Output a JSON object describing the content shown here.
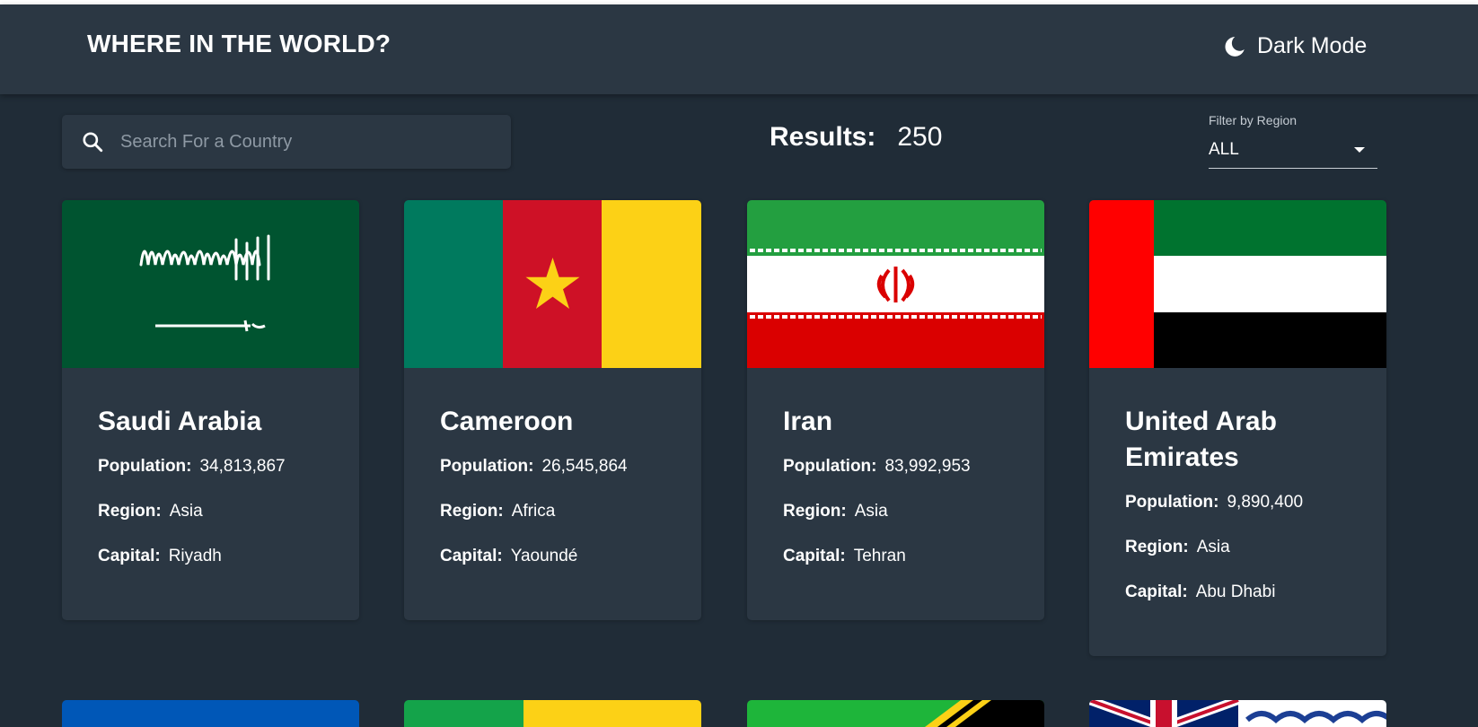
{
  "header": {
    "title": "WHERE IN THE WORLD?",
    "theme_toggle_label": "Dark Mode",
    "theme_toggle_icon": "moon-icon"
  },
  "search": {
    "placeholder": "Search For a Country",
    "value": "",
    "icon": "search-icon"
  },
  "results": {
    "label": "Results:",
    "count": "250"
  },
  "filter": {
    "label": "Filter by Region",
    "selected": "ALL"
  },
  "labels": {
    "population": "Population:",
    "region": "Region:",
    "capital": "Capital:"
  },
  "countries": [
    {
      "name": "Saudi Arabia",
      "population": "34,813,867",
      "region": "Asia",
      "capital": "Riyadh",
      "flag": "saudi-arabia-flag"
    },
    {
      "name": "Cameroon",
      "population": "26,545,864",
      "region": "Africa",
      "capital": "Yaoundé",
      "flag": "cameroon-flag"
    },
    {
      "name": "Iran",
      "population": "83,992,953",
      "region": "Asia",
      "capital": "Tehran",
      "flag": "iran-flag"
    },
    {
      "name": "United Arab Emirates",
      "population": "9,890,400",
      "region": "Asia",
      "capital": "Abu Dhabi",
      "flag": "uae-flag"
    }
  ],
  "colors": {
    "background": "#202c37",
    "surface": "#2b3743",
    "text": "#ffffff",
    "placeholder": "#8e99a4"
  }
}
